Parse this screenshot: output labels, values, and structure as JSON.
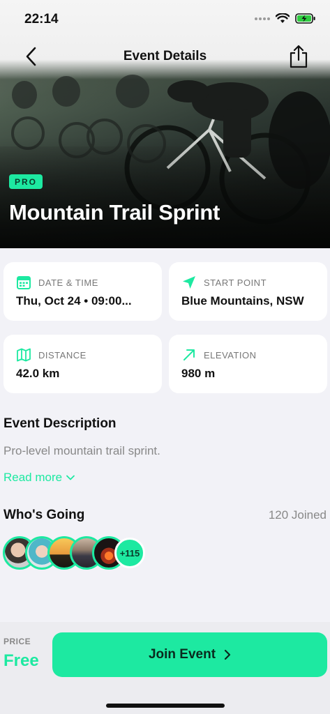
{
  "status": {
    "time": "22:14"
  },
  "nav": {
    "title": "Event Details"
  },
  "event": {
    "badge": "PRO",
    "title": "Mountain Trail Sprint"
  },
  "details": [
    {
      "label": "DATE & TIME",
      "value": "Thu, Oct 24 • 09:00...",
      "icon": "calendar-icon"
    },
    {
      "label": "START POINT",
      "value": "Blue Mountains, NSW",
      "icon": "location-arrow-icon"
    },
    {
      "label": "DISTANCE",
      "value": "42.0 km",
      "icon": "map-icon"
    },
    {
      "label": "ELEVATION",
      "value": "980 m",
      "icon": "trend-up-arrow-icon"
    }
  ],
  "description": {
    "heading": "Event Description",
    "text": "Pro-level mountain trail sprint.",
    "read_more": "Read more"
  },
  "attendees": {
    "heading": "Who's Going",
    "joined": "120 Joined",
    "more": "+115"
  },
  "footer": {
    "price_label": "PRICE",
    "price": "Free",
    "cta": "Join Event"
  },
  "colors": {
    "accent": "#1de9a1",
    "background": "#f2f2f7"
  }
}
